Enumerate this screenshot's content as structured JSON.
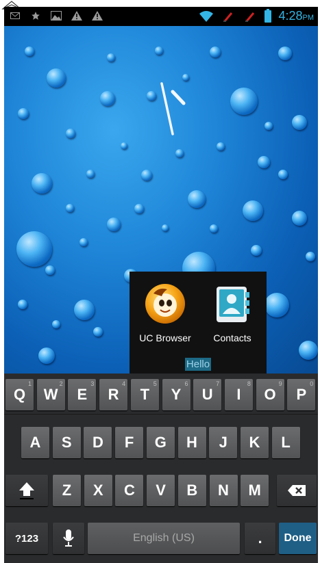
{
  "status_bar": {
    "time": "4:28",
    "ampm": "PM",
    "left_icons": [
      "mail-icon",
      "star-icon",
      "image-icon",
      "warning-icon",
      "warning-icon"
    ],
    "right_icons": [
      "wifi-icon",
      "no-signal-icon",
      "no-signal-icon",
      "battery-icon"
    ]
  },
  "folder": {
    "name": "Hello",
    "apps": [
      {
        "label": "UC Browser",
        "icon": "uc-browser-icon"
      },
      {
        "label": "Contacts",
        "icon": "contacts-icon"
      }
    ]
  },
  "keyboard": {
    "row1": [
      {
        "label": "Q",
        "hint": "1"
      },
      {
        "label": "W",
        "hint": "2"
      },
      {
        "label": "E",
        "hint": "3"
      },
      {
        "label": "R",
        "hint": "4"
      },
      {
        "label": "T",
        "hint": "5"
      },
      {
        "label": "Y",
        "hint": "6"
      },
      {
        "label": "U",
        "hint": "7"
      },
      {
        "label": "I",
        "hint": "8"
      },
      {
        "label": "O",
        "hint": "9"
      },
      {
        "label": "P",
        "hint": "0"
      }
    ],
    "row2": [
      "A",
      "S",
      "D",
      "F",
      "G",
      "H",
      "J",
      "K",
      "L"
    ],
    "row3": [
      "Z",
      "X",
      "C",
      "V",
      "B",
      "N",
      "M"
    ],
    "symbols_label": "?123",
    "space_label": "English (US)",
    "period_label": ".",
    "done_label": "Done",
    "accent": "#1f5f86"
  }
}
